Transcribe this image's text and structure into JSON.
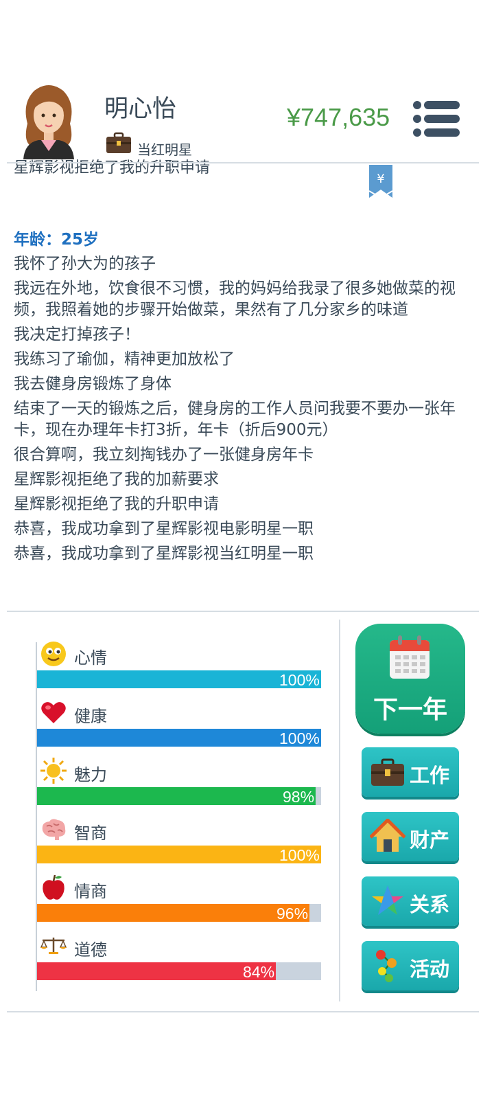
{
  "header": {
    "name": "明心怡",
    "job": "当红明星",
    "money": "¥747,635",
    "money_color": "#4a9a48"
  },
  "log": {
    "clipped_line": "星辉影视拒绝了我的升职申请",
    "bookmark_symbol": "¥",
    "age": "年龄：25岁",
    "lines": [
      "我怀了孙大为的孩子",
      "我远在外地，饮食很不习惯，我的妈妈给我录了很多她做菜的视频，我照着她的步骤开始做菜，果然有了几分家乡的味道",
      "我决定打掉孩子！",
      "我练习了瑜伽，精神更加放松了",
      "我去健身房锻炼了身体",
      "结束了一天的锻炼之后，健身房的工作人员问我要不要办一张年卡，现在办理年卡打3折，年卡（折后900元）",
      "很合算啊，我立刻掏钱办了一张健身房年卡",
      "星辉影视拒绝了我的加薪要求",
      "星辉影视拒绝了我的升职申请",
      "恭喜，我成功拿到了星辉影视电影明星一职",
      "恭喜，我成功拿到了星辉影视当红明星一职"
    ]
  },
  "stats": [
    {
      "name": "心情",
      "icon": "smiley-icon",
      "value": 100,
      "label": "100%",
      "color": "#1ab4d6"
    },
    {
      "name": "健康",
      "icon": "heart-icon",
      "value": 100,
      "label": "100%",
      "color": "#1e88d8"
    },
    {
      "name": "魅力",
      "icon": "sun-icon",
      "value": 98,
      "label": "98%",
      "color": "#1cb84e"
    },
    {
      "name": "智商",
      "icon": "brain-icon",
      "value": 100,
      "label": "100%",
      "color": "#fbb414"
    },
    {
      "name": "情商",
      "icon": "apple-icon",
      "value": 96,
      "label": "96%",
      "color": "#fa7f0a"
    },
    {
      "name": "道德",
      "icon": "scales-icon",
      "value": 84,
      "label": "84%",
      "color": "#ee3344"
    }
  ],
  "actions": {
    "next_year": "下一年",
    "work": "工作",
    "property": "财产",
    "relations": "关系",
    "activities": "活动"
  }
}
